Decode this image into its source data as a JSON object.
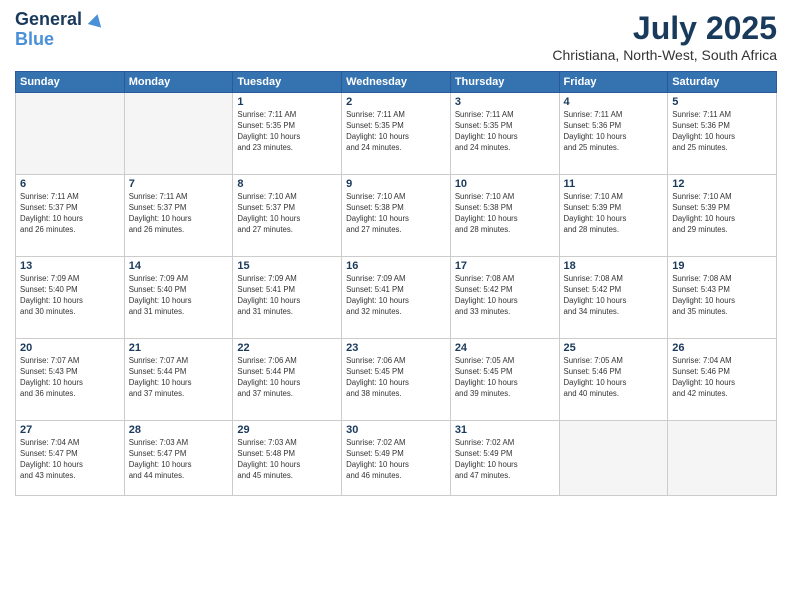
{
  "header": {
    "logo_line1": "General",
    "logo_line2": "Blue",
    "month_title": "July 2025",
    "location": "Christiana, North-West, South Africa"
  },
  "days_of_week": [
    "Sunday",
    "Monday",
    "Tuesday",
    "Wednesday",
    "Thursday",
    "Friday",
    "Saturday"
  ],
  "weeks": [
    [
      {
        "day": "",
        "detail": ""
      },
      {
        "day": "",
        "detail": ""
      },
      {
        "day": "1",
        "detail": "Sunrise: 7:11 AM\nSunset: 5:35 PM\nDaylight: 10 hours\nand 23 minutes."
      },
      {
        "day": "2",
        "detail": "Sunrise: 7:11 AM\nSunset: 5:35 PM\nDaylight: 10 hours\nand 24 minutes."
      },
      {
        "day": "3",
        "detail": "Sunrise: 7:11 AM\nSunset: 5:35 PM\nDaylight: 10 hours\nand 24 minutes."
      },
      {
        "day": "4",
        "detail": "Sunrise: 7:11 AM\nSunset: 5:36 PM\nDaylight: 10 hours\nand 25 minutes."
      },
      {
        "day": "5",
        "detail": "Sunrise: 7:11 AM\nSunset: 5:36 PM\nDaylight: 10 hours\nand 25 minutes."
      }
    ],
    [
      {
        "day": "6",
        "detail": "Sunrise: 7:11 AM\nSunset: 5:37 PM\nDaylight: 10 hours\nand 26 minutes."
      },
      {
        "day": "7",
        "detail": "Sunrise: 7:11 AM\nSunset: 5:37 PM\nDaylight: 10 hours\nand 26 minutes."
      },
      {
        "day": "8",
        "detail": "Sunrise: 7:10 AM\nSunset: 5:37 PM\nDaylight: 10 hours\nand 27 minutes."
      },
      {
        "day": "9",
        "detail": "Sunrise: 7:10 AM\nSunset: 5:38 PM\nDaylight: 10 hours\nand 27 minutes."
      },
      {
        "day": "10",
        "detail": "Sunrise: 7:10 AM\nSunset: 5:38 PM\nDaylight: 10 hours\nand 28 minutes."
      },
      {
        "day": "11",
        "detail": "Sunrise: 7:10 AM\nSunset: 5:39 PM\nDaylight: 10 hours\nand 28 minutes."
      },
      {
        "day": "12",
        "detail": "Sunrise: 7:10 AM\nSunset: 5:39 PM\nDaylight: 10 hours\nand 29 minutes."
      }
    ],
    [
      {
        "day": "13",
        "detail": "Sunrise: 7:09 AM\nSunset: 5:40 PM\nDaylight: 10 hours\nand 30 minutes."
      },
      {
        "day": "14",
        "detail": "Sunrise: 7:09 AM\nSunset: 5:40 PM\nDaylight: 10 hours\nand 31 minutes."
      },
      {
        "day": "15",
        "detail": "Sunrise: 7:09 AM\nSunset: 5:41 PM\nDaylight: 10 hours\nand 31 minutes."
      },
      {
        "day": "16",
        "detail": "Sunrise: 7:09 AM\nSunset: 5:41 PM\nDaylight: 10 hours\nand 32 minutes."
      },
      {
        "day": "17",
        "detail": "Sunrise: 7:08 AM\nSunset: 5:42 PM\nDaylight: 10 hours\nand 33 minutes."
      },
      {
        "day": "18",
        "detail": "Sunrise: 7:08 AM\nSunset: 5:42 PM\nDaylight: 10 hours\nand 34 minutes."
      },
      {
        "day": "19",
        "detail": "Sunrise: 7:08 AM\nSunset: 5:43 PM\nDaylight: 10 hours\nand 35 minutes."
      }
    ],
    [
      {
        "day": "20",
        "detail": "Sunrise: 7:07 AM\nSunset: 5:43 PM\nDaylight: 10 hours\nand 36 minutes."
      },
      {
        "day": "21",
        "detail": "Sunrise: 7:07 AM\nSunset: 5:44 PM\nDaylight: 10 hours\nand 37 minutes."
      },
      {
        "day": "22",
        "detail": "Sunrise: 7:06 AM\nSunset: 5:44 PM\nDaylight: 10 hours\nand 37 minutes."
      },
      {
        "day": "23",
        "detail": "Sunrise: 7:06 AM\nSunset: 5:45 PM\nDaylight: 10 hours\nand 38 minutes."
      },
      {
        "day": "24",
        "detail": "Sunrise: 7:05 AM\nSunset: 5:45 PM\nDaylight: 10 hours\nand 39 minutes."
      },
      {
        "day": "25",
        "detail": "Sunrise: 7:05 AM\nSunset: 5:46 PM\nDaylight: 10 hours\nand 40 minutes."
      },
      {
        "day": "26",
        "detail": "Sunrise: 7:04 AM\nSunset: 5:46 PM\nDaylight: 10 hours\nand 42 minutes."
      }
    ],
    [
      {
        "day": "27",
        "detail": "Sunrise: 7:04 AM\nSunset: 5:47 PM\nDaylight: 10 hours\nand 43 minutes."
      },
      {
        "day": "28",
        "detail": "Sunrise: 7:03 AM\nSunset: 5:47 PM\nDaylight: 10 hours\nand 44 minutes."
      },
      {
        "day": "29",
        "detail": "Sunrise: 7:03 AM\nSunset: 5:48 PM\nDaylight: 10 hours\nand 45 minutes."
      },
      {
        "day": "30",
        "detail": "Sunrise: 7:02 AM\nSunset: 5:49 PM\nDaylight: 10 hours\nand 46 minutes."
      },
      {
        "day": "31",
        "detail": "Sunrise: 7:02 AM\nSunset: 5:49 PM\nDaylight: 10 hours\nand 47 minutes."
      },
      {
        "day": "",
        "detail": ""
      },
      {
        "day": "",
        "detail": ""
      }
    ]
  ]
}
